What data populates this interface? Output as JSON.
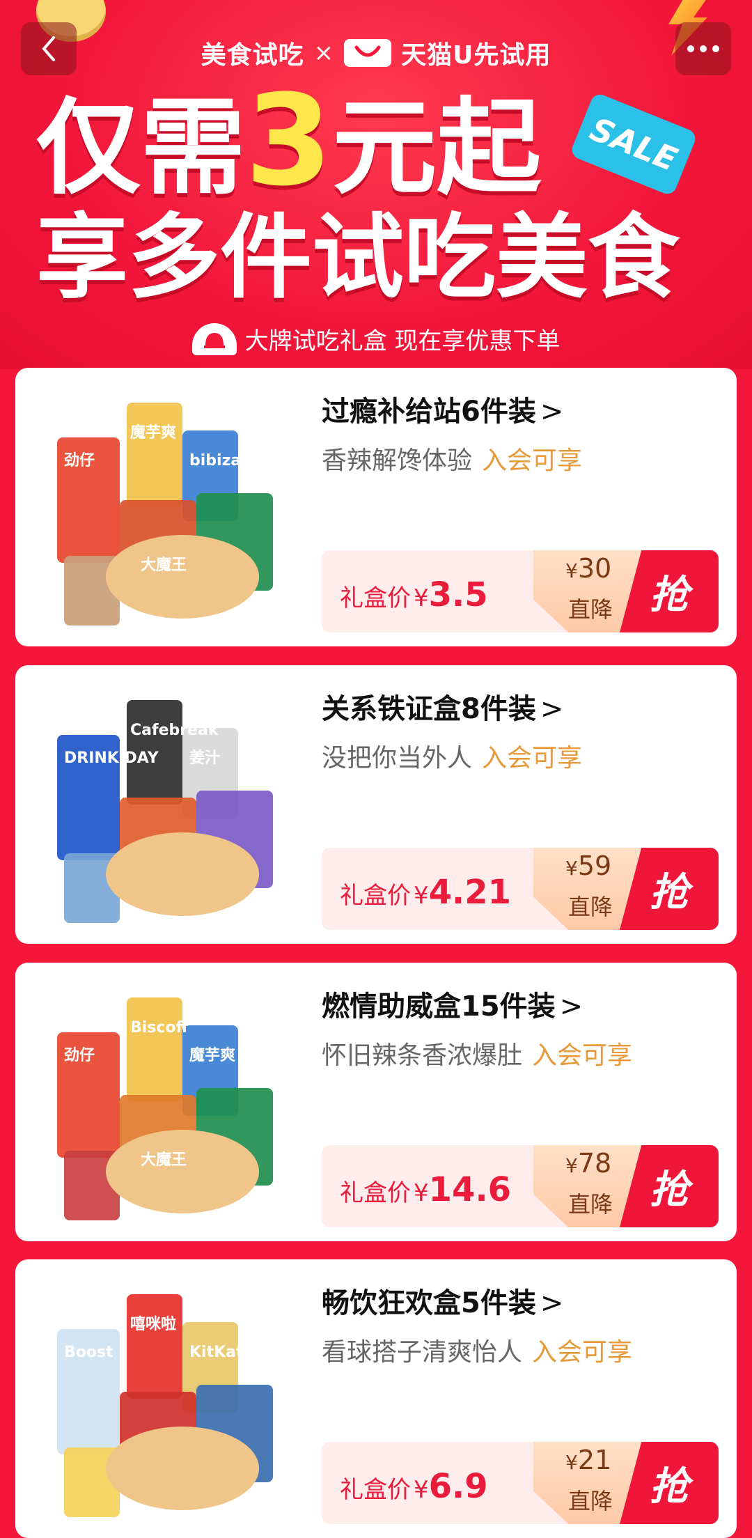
{
  "header": {
    "brand_left": "美食试吃",
    "brand_x": "×",
    "brand_right": "天猫U先试用",
    "headline_pre": "仅需",
    "headline_num": "3",
    "headline_post": "元起",
    "sale_tag": "SALE",
    "headline2": "享多件试吃美食",
    "subline": "大牌试吃礼盒 现在享优惠下单"
  },
  "products": [
    {
      "title": "过瘾补给站6件装",
      "desc": "香辣解馋体验",
      "member": "入会可享",
      "price_label": "礼盒价",
      "price": "3.5",
      "save": "30",
      "drop": "直降",
      "grab": "抢"
    },
    {
      "title": "关系铁证盒8件装",
      "desc": "没把你当外人",
      "member": "入会可享",
      "price_label": "礼盒价",
      "price": "4.21",
      "save": "59",
      "drop": "直降",
      "grab": "抢"
    },
    {
      "title": "燃情助威盒15件装",
      "desc": "怀旧辣条香浓爆肚",
      "member": "入会可享",
      "price_label": "礼盒价",
      "price": "14.6",
      "save": "78",
      "drop": "直降",
      "grab": "抢"
    },
    {
      "title": "畅饮狂欢盒5件装",
      "desc": "看球搭子清爽怡人",
      "member": "入会可享",
      "price_label": "礼盒价",
      "price": "6.9",
      "save": "21",
      "drop": "直降",
      "grab": "抢"
    }
  ],
  "image_labels": {
    "p1": [
      "劲仔",
      "魔芋爽",
      "bibizan",
      "大魔王"
    ],
    "p2": [
      "DRINK DAY",
      "Cafebreak",
      "姜汁"
    ],
    "p3": [
      "劲仔",
      "Biscoff",
      "魔芋爽",
      "大魔王"
    ],
    "p4": [
      "Boost",
      "嘻咪啦",
      "KitKat"
    ]
  },
  "colors": {
    "bg": "#f5173a",
    "price": "#ea1c3c",
    "member": "#e69a3a",
    "grab": "#f0163a"
  },
  "icons": {
    "back": "chevron-left-icon",
    "more": "more-icon",
    "cloche": "cloche-icon"
  }
}
